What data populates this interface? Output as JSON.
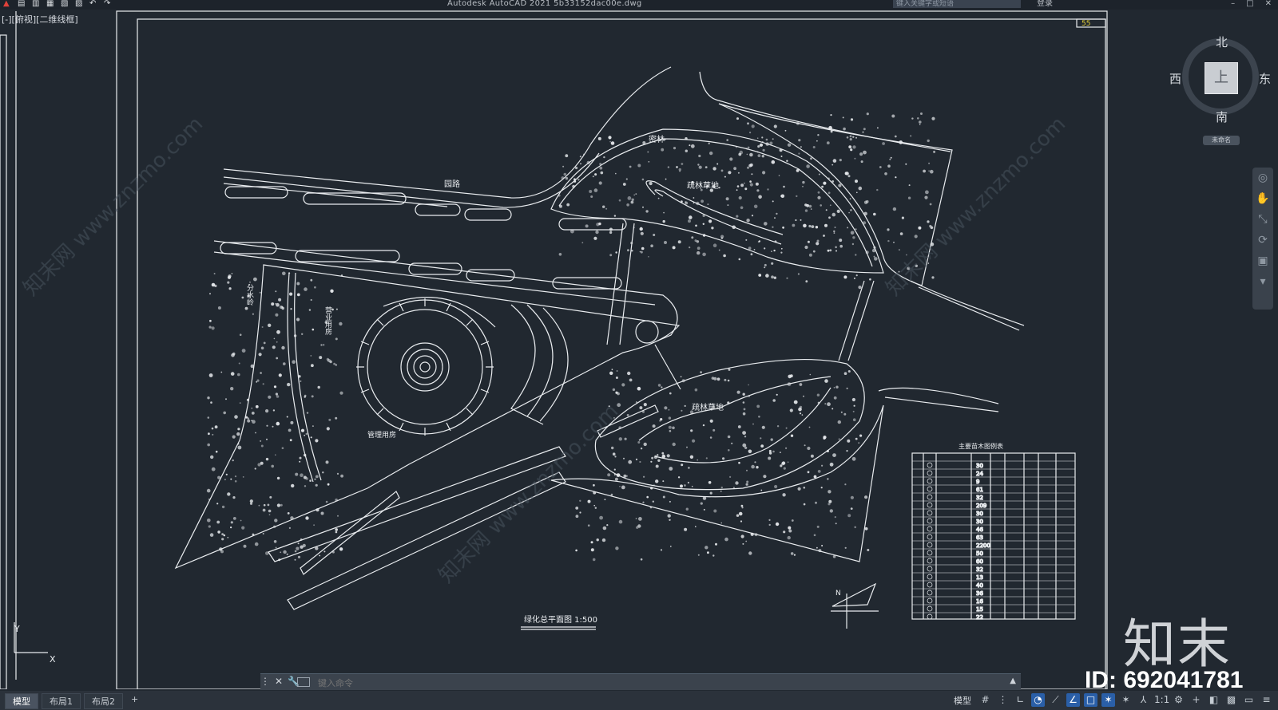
{
  "app": {
    "title": "Autodesk AutoCAD 2021    5b33152dac00e.dwg",
    "search_placeholder": "键入关键字或短语",
    "login_label": "登录"
  },
  "viewport": {
    "label": "[-][俯视][二维线框]"
  },
  "viewcube": {
    "north": "北",
    "south": "南",
    "west": "西",
    "east": "东",
    "face": "上",
    "ucs": "未命名"
  },
  "drawing": {
    "sheet_number": "55",
    "road_label": "园路",
    "woodland_label_1": "疏林草地",
    "woodland_label_2": "疏林草地",
    "label_grove": "密林",
    "label_water_a": "分水岭",
    "label_business": "营业用房",
    "label_mgmt": "管理用房",
    "plan_title": "绿化总平面图   1:500",
    "legend_title": "主要苗木图例表",
    "north_mark": "N",
    "ucs_y": "Y",
    "ucs_x": "X",
    "legend_numbers": [
      "30",
      "24",
      "9",
      "61",
      "32",
      "209",
      "30",
      "30",
      "46",
      "63",
      "2200",
      "50",
      "60",
      "32",
      "13",
      "40",
      "36",
      "16",
      "15",
      "22"
    ]
  },
  "command": {
    "placeholder": "键入命令"
  },
  "layout_tabs": {
    "model": "模型",
    "layout1": "布局1",
    "layout2": "布局2",
    "add": "+"
  },
  "status": {
    "mode": "模型",
    "scale": "1:1"
  },
  "watermark": {
    "logo": "知末",
    "id": "ID: 692041781",
    "site": "知末网 www.znzmo.com"
  },
  "colors": {
    "background": "#212830",
    "lines": "#e9ecef",
    "accent": "#2a5fa8",
    "sheet_number": "#e5d23a"
  }
}
